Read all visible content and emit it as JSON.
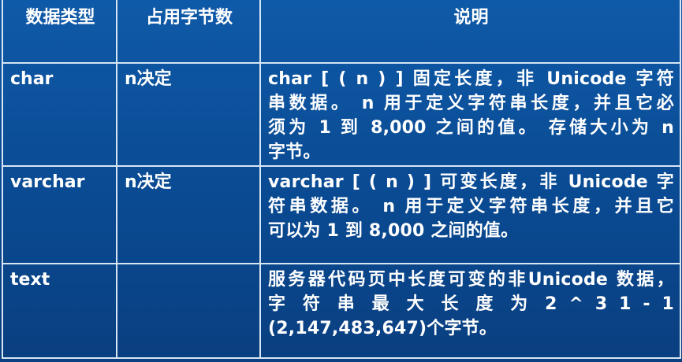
{
  "table": {
    "headers": [
      "数据类型",
      "占用字节数",
      "说明"
    ],
    "rows": [
      {
        "type": "char",
        "bytes": "n决定",
        "desc_lines": [
          "char [ ( n ) ] 固定长度，非 Unicode 字符",
          "串数据。 n 用于定义字符串长度，并且它必",
          "须为 1 到 8,000 之间的值。 存储大小为 n",
          "字节。"
        ]
      },
      {
        "type": "varchar",
        "bytes": "n决定",
        "desc_lines": [
          "varchar [ ( n ) ] 可变长度，非 Unicode 字",
          "符串数据。 n 用于定义字符串长度，并且它",
          "可以为 1 到 8,000 之间的值。"
        ]
      },
      {
        "type": "text",
        "bytes": "",
        "desc_lines": [
          "服务器代码页中长度可变的非Unicode 数据，",
          "字 符 串 最 大 长 度 为   2 ^ 3 1 - 1",
          "(2,147,483,647)个字节。"
        ]
      }
    ]
  }
}
